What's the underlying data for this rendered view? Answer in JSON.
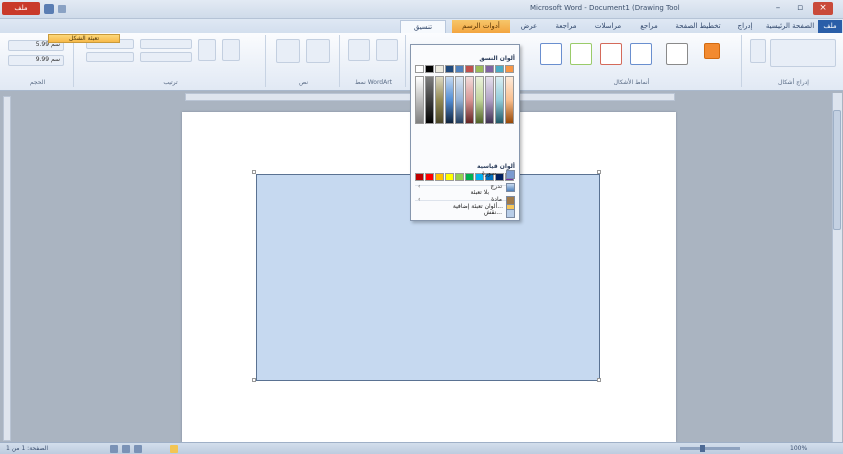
{
  "window": {
    "app_button": "ملف",
    "title": "Microsoft Word - Document1 (Drawing Tools)",
    "controls": [
      "–",
      "▫",
      "×"
    ]
  },
  "tabs": [
    {
      "label": "تنسيق",
      "active": true
    },
    {
      "label": "أدوات الرسم",
      "context": true
    },
    {
      "label": "عرض"
    },
    {
      "label": "مراجعة"
    },
    {
      "label": "مراسلات"
    },
    {
      "label": "مراجع"
    },
    {
      "label": "تخطيط الصفحة"
    },
    {
      "label": "إدراج"
    },
    {
      "label": "الصفحة الرئيسية"
    },
    {
      "label": "ملف",
      "blue": true
    }
  ],
  "ribbon": {
    "groups": [
      {
        "label": "الحجم"
      },
      {
        "label": "ترتيب"
      },
      {
        "label": "نص"
      },
      {
        "label": "نمط WordArt"
      },
      {
        "label": "أنماط الأشكال"
      },
      {
        "label": "إدراج أشكال"
      }
    ],
    "size_values": [
      "5.99 سم",
      "9.99 سم"
    ]
  },
  "dropdown": {
    "header_button": "تعبئة الشكل",
    "theme_colors_label": "ألوان النسق",
    "standard_colors_label": "ألوان قياسية",
    "no_fill": "بلا تعبئة",
    "more_colors": "ألوان تعبئة إضافية...",
    "picture": "صورة...",
    "gradient": "تدرج",
    "texture": "مادة",
    "pattern": "نقش...",
    "theme_columns": [
      {
        "top": "#ffffff",
        "grad": [
          "#ffffff",
          "#bfbfbf",
          "#7f7f7f"
        ]
      },
      {
        "top": "#000000",
        "grad": [
          "#7f7f7f",
          "#404040",
          "#000000"
        ]
      },
      {
        "top": "#eeece1",
        "grad": [
          "#ddd9c3",
          "#948a54",
          "#4a452a"
        ]
      },
      {
        "top": "#1f497d",
        "grad": [
          "#c6d9f0",
          "#538ed5",
          "#0f243e"
        ]
      },
      {
        "top": "#4f81bd",
        "grad": [
          "#dbe5f1",
          "#95b3d7",
          "#244061"
        ]
      },
      {
        "top": "#c0504d",
        "grad": [
          "#f2dcdb",
          "#d99694",
          "#632423"
        ]
      },
      {
        "top": "#9bbb59",
        "grad": [
          "#ebf1dd",
          "#c3d69b",
          "#4f6128"
        ]
      },
      {
        "top": "#8064a2",
        "grad": [
          "#e5e0ec",
          "#b2a1c7",
          "#3f3151"
        ]
      },
      {
        "top": "#4bacc6",
        "grad": [
          "#dbeef3",
          "#92cddc",
          "#205867"
        ]
      },
      {
        "top": "#f79646",
        "grad": [
          "#fdeada",
          "#fac08f",
          "#974806"
        ]
      }
    ],
    "standard_colors": [
      "#c00000",
      "#ff0000",
      "#ffc000",
      "#ffff00",
      "#92d050",
      "#00b050",
      "#00b0f0",
      "#0070c0",
      "#002060",
      "#7030a0"
    ]
  },
  "statusbar": {
    "left_text": "الصفحة: 1 من 1",
    "right_text": "100%"
  }
}
